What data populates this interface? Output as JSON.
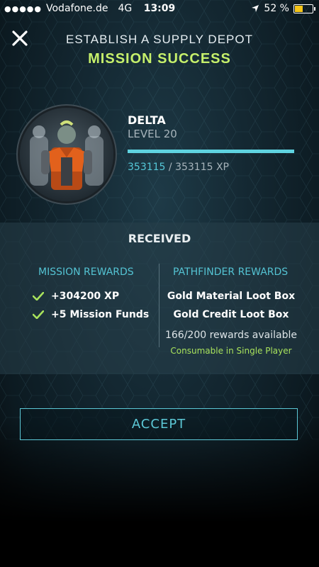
{
  "status_bar": {
    "carrier": "Vodafone.de",
    "network": "4G",
    "time": "13:09",
    "battery_percent_text": "52 %",
    "battery_level": 0.52,
    "signal_dots": "●●●●●"
  },
  "header": {
    "title": "ESTABLISH A SUPPLY DEPOT",
    "subtitle": "MISSION SUCCESS",
    "close_icon": "close-icon"
  },
  "character": {
    "name": "DELTA",
    "level": "LEVEL 20",
    "xp_current": "353115",
    "xp_separator": "/ 353115 XP",
    "xp_progress": 1.0
  },
  "received": {
    "title": "RECEIVED",
    "mission_rewards_header": "MISSION REWARDS",
    "mission_rewards": [
      {
        "text": "+304200 XP"
      },
      {
        "text": "+5 Mission Funds"
      }
    ],
    "pathfinder_header": "PATHFINDER REWARDS",
    "pathfinder_rewards": [
      {
        "text": "Gold Material Loot Box"
      },
      {
        "text": "Gold Credit Loot Box"
      }
    ],
    "availability": "166/200 rewards available",
    "consumable_note": "Consumable in Single Player"
  },
  "actions": {
    "accept_label": "ACCEPT"
  },
  "colors": {
    "accent_cyan": "#55c8d8",
    "success_green": "#c6f06b",
    "check_green": "#a8e25c"
  }
}
